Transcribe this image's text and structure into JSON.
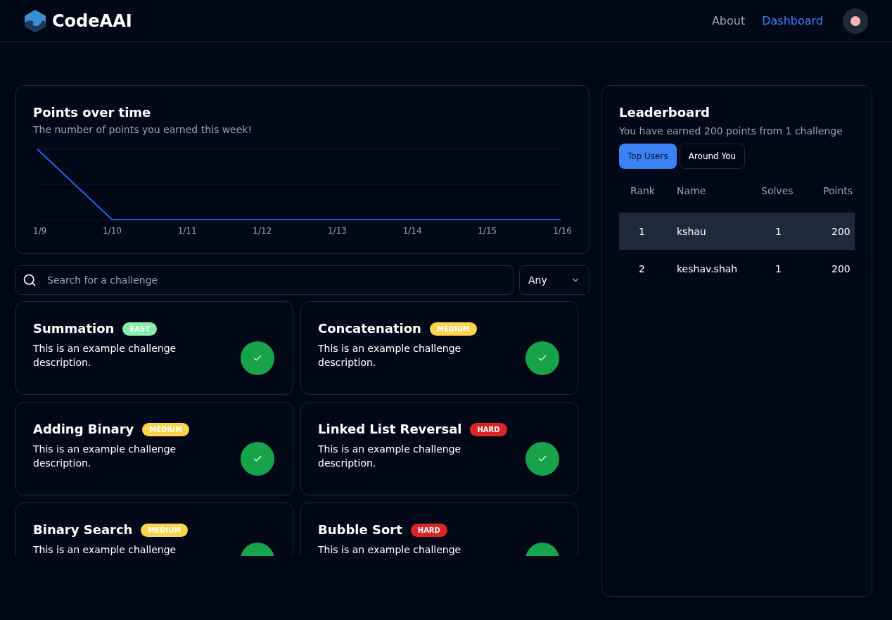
{
  "nav": {
    "brand": "CodeAAI",
    "links": [
      {
        "label": "About",
        "selected": false
      },
      {
        "label": "Dashboard",
        "selected": true
      }
    ]
  },
  "points_card": {
    "title": "Points over time",
    "subtitle": "The number of points you earned this week!",
    "x_labels": [
      "1/9",
      "1/10",
      "1/11",
      "1/12",
      "1/13",
      "1/14",
      "1/15",
      "1/16"
    ]
  },
  "search": {
    "placeholder": "Search for a challenge"
  },
  "filter": {
    "value": "Any"
  },
  "challenges": [
    {
      "title": "Summation",
      "difficulty": "EASY",
      "color": "#86efac",
      "description": "This is an example challenge description.",
      "completed": true
    },
    {
      "title": "Concatenation",
      "difficulty": "MEDIUM",
      "color": "#fcd34d",
      "description": "This is an example challenge description.",
      "completed": true
    },
    {
      "title": "Adding Binary",
      "difficulty": "MEDIUM",
      "color": "#fcd34d",
      "description": "This is an example challenge description.",
      "completed": true
    },
    {
      "title": "Linked List Reversal",
      "difficulty": "HARD",
      "color": "#dc2626",
      "description": "This is an example challenge description.",
      "completed": true
    },
    {
      "title": "Binary Search",
      "difficulty": "MEDIUM",
      "color": "#fcd34d",
      "description": "This is an example challenge",
      "completed": true
    },
    {
      "title": "Bubble Sort",
      "difficulty": "HARD",
      "color": "#dc2626",
      "description": "This is an example challenge",
      "completed": true
    }
  ],
  "leaderboard": {
    "title": "Leaderboard",
    "subtitle": "You have earned 200 points from 1 challenge",
    "tabs": [
      {
        "label": "Top Users",
        "selected": true
      },
      {
        "label": "Around You",
        "selected": false
      }
    ],
    "columns": [
      "Rank",
      "Name",
      "Solves",
      "Points"
    ],
    "rows": [
      {
        "rank": "1",
        "name": "kshau",
        "solves": "1",
        "points": "200",
        "selected": true
      },
      {
        "rank": "2",
        "name": "keshav.shah",
        "solves": "1",
        "points": "200",
        "selected": false
      }
    ]
  }
}
